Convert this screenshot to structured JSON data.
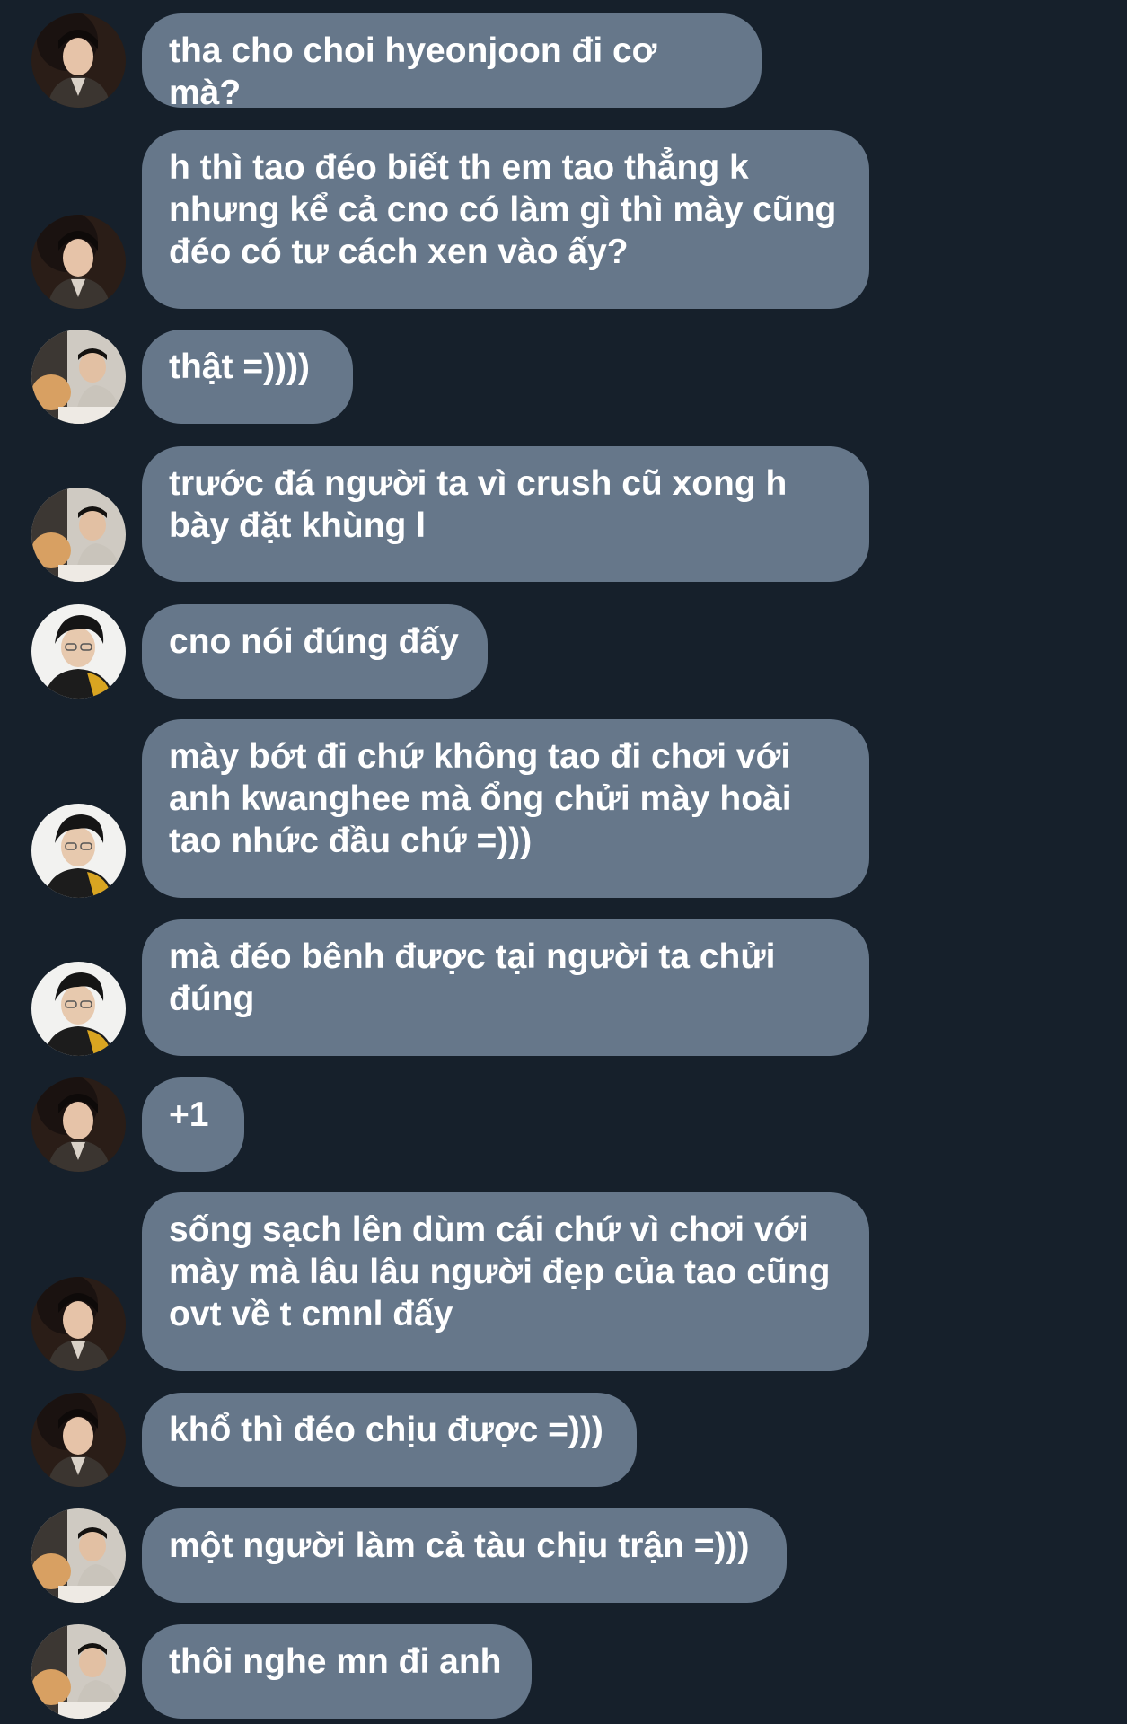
{
  "colors": {
    "background": "#16202b",
    "bubble": "#66778a",
    "text": "#ffffff"
  },
  "messages": [
    {
      "text": "tha cho choi hyeonjoon đi cơ mà?",
      "avatar": "avatar-a"
    },
    {
      "text": "h thì tao đéo biết th em tao thẳng k\nnhưng kể cả cno có làm gì thì mày cũng\nđéo có tư cách xen vào ấy?",
      "avatar": "avatar-a"
    },
    {
      "text": "thật =))))",
      "avatar": "avatar-b"
    },
    {
      "text": "trước đá người ta vì crush cũ xong h\nbày đặt khùng l",
      "avatar": "avatar-b"
    },
    {
      "text": "cno nói đúng đấy",
      "avatar": "avatar-c"
    },
    {
      "text": "mày bớt đi chứ không tao đi chơi với\nanh kwanghee mà ổng chửi mày hoài\ntao nhức đầu chứ =)))",
      "avatar": "avatar-c"
    },
    {
      "text": "mà đéo bênh được tại người ta chửi\nđúng",
      "avatar": "avatar-c"
    },
    {
      "text": "+1",
      "avatar": "avatar-a"
    },
    {
      "text": "sống sạch lên dùm cái chứ vì chơi với\nmày mà lâu lâu người đẹp của tao cũng\novt về t cmnl đấy",
      "avatar": "avatar-a"
    },
    {
      "text": "khổ thì đéo chịu được =)))",
      "avatar": "avatar-a"
    },
    {
      "text": "một người làm cả tàu chịu trận =)))",
      "avatar": "avatar-b"
    },
    {
      "text": "thôi nghe mn đi anh",
      "avatar": "avatar-b"
    }
  ]
}
